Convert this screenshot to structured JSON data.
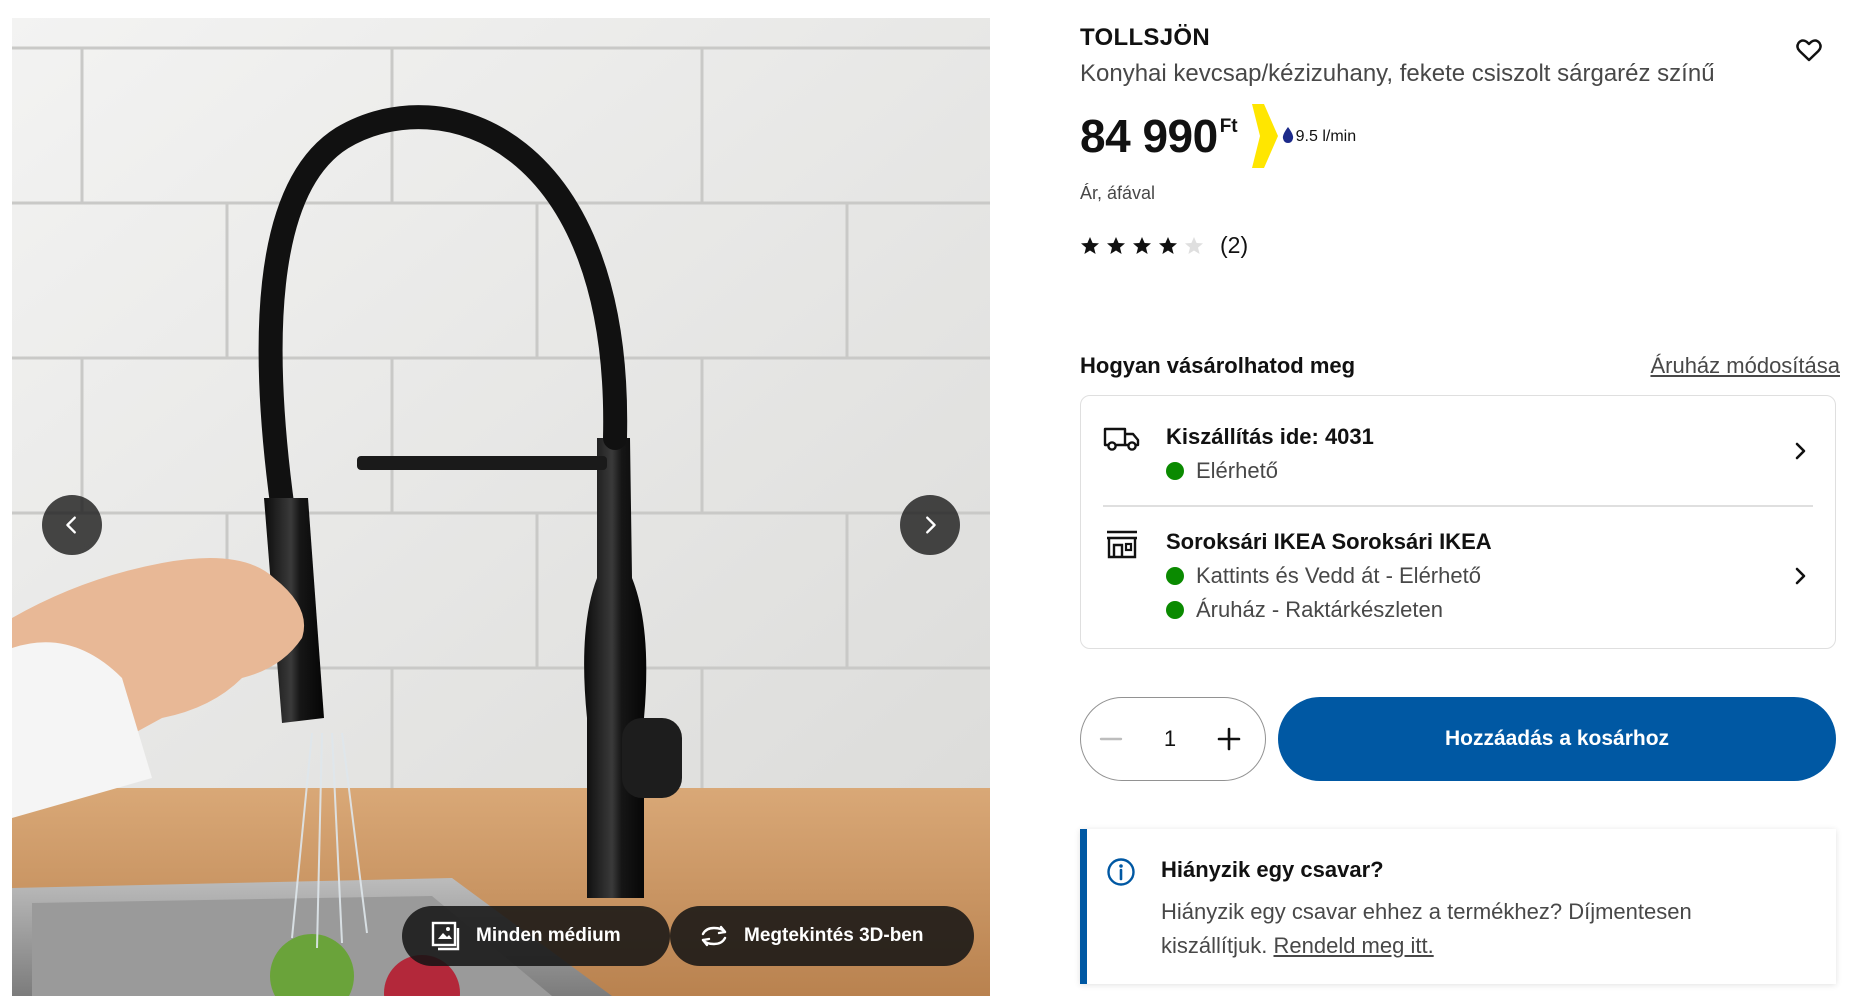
{
  "media": {
    "all_media_label": "Minden médium",
    "view_3d_label": "Megtekintés 3D-ben",
    "icons": {
      "prev": "chevron-left-icon",
      "next": "chevron-right-icon",
      "all_media": "gallery-icon",
      "view_3d": "rotate-3d-icon"
    }
  },
  "product": {
    "name": "TOLLSJÖN",
    "description": "Konyhai kevcsap/kézizuhany, fekete csiszolt sárgaréz színű",
    "price": "84 990",
    "currency": "Ft",
    "water_flow": "9.5 l/min",
    "vat_note": "Ár, áfával",
    "rating": {
      "stars": 4,
      "max": 5,
      "count": "(2)"
    }
  },
  "purchase": {
    "title": "Hogyan vásárolhatod meg",
    "change_store": "Áruház módosítása",
    "delivery": {
      "title": "Kiszállítás ide: 4031",
      "status": "Elérhető"
    },
    "store": {
      "title": "Soroksári IKEA Soroksári IKEA",
      "status_click_collect": "Kattints és Vedd át - Elérhető",
      "status_store": "Áruház - Raktárkészleten"
    },
    "quantity": "1",
    "add_to_cart": "Hozzáadás a kosárhoz"
  },
  "notice": {
    "title": "Hiányzik egy csavar?",
    "text": "Hiányzik egy csavar ehhez a termékhez? Díjmentesen kiszállítjuk. ",
    "link": "Rendeld meg itt."
  },
  "colors": {
    "brand_blue": "#0058a3",
    "available_green": "#0a8a00",
    "water_badge_yellow": "#ffe600"
  }
}
